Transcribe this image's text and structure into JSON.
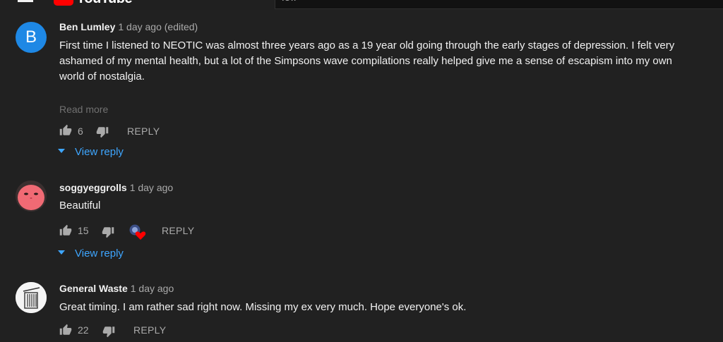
{
  "topbar": {
    "logo_text": "YouTube",
    "search_value": "lofi"
  },
  "comments": [
    {
      "avatar_letter": "B",
      "author": "Ben Lumley",
      "time": "1 day ago (edited)",
      "text": "First time I listened to NEOTIC was almost three years ago as a 19 year old going through the early stages of depression. I felt very ashamed of my mental health, but a lot of the Simpsons wave compilations really helped give me a sense of escapism into my own world of nostalgia.",
      "read_more": "Read more",
      "likes": "6",
      "reply_label": "REPLY",
      "view_reply": "View reply"
    },
    {
      "author": "soggyeggrolls",
      "time": "1 day ago",
      "text": "Beautiful",
      "likes": "15",
      "reply_label": "REPLY",
      "view_reply": "View reply"
    },
    {
      "author": "General Waste",
      "time": "1 day ago",
      "text": "Great timing. I am rather sad right now. Missing my ex very much. Hope everyone's ok.",
      "likes": "22",
      "reply_label": "REPLY"
    }
  ],
  "colors": {
    "background": "#212121",
    "link_blue": "#3ea6ff",
    "avatar_blue": "#1e88e5",
    "heart_red": "#ff0000"
  }
}
